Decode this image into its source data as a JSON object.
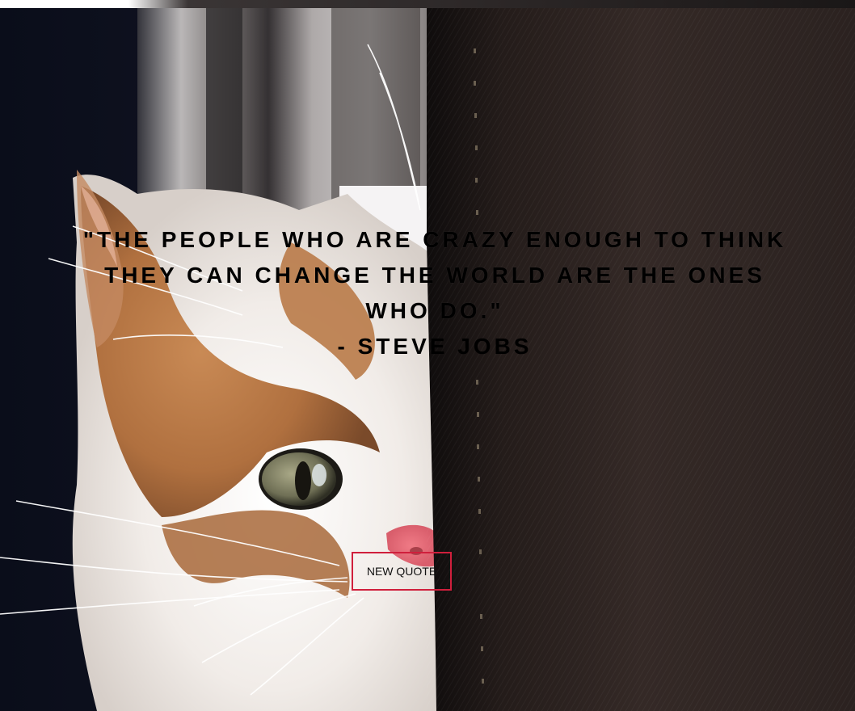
{
  "quote": {
    "text": "\"The people who are crazy enough to think they can change the world are the ones who do.\"",
    "author": "- Steve Jobs"
  },
  "button": {
    "new_quote_label": "New Quote"
  },
  "colors": {
    "button_border": "#d01f3c",
    "quote_text": "#000000",
    "curtain": "#2a2220"
  },
  "background": {
    "image_subject": "kitten-peeking-behind-curtain"
  }
}
